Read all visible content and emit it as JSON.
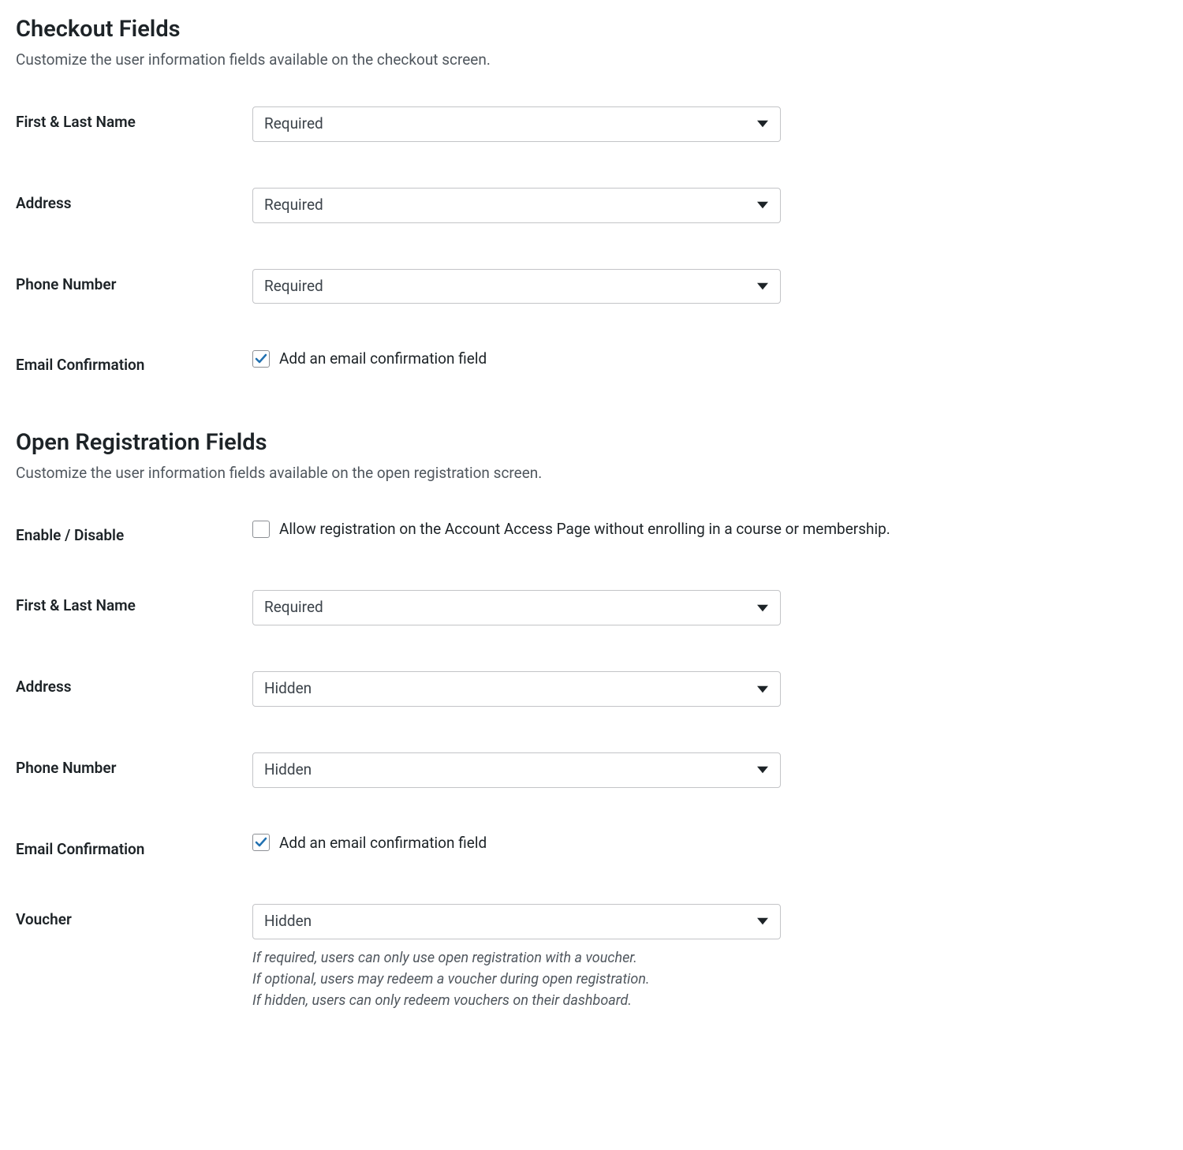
{
  "checkout": {
    "title": "Checkout Fields",
    "description": "Customize the user information fields available on the checkout screen.",
    "fields": {
      "first_last_name": {
        "label": "First & Last Name",
        "value": "Required"
      },
      "address": {
        "label": "Address",
        "value": "Required"
      },
      "phone": {
        "label": "Phone Number",
        "value": "Required"
      },
      "email_confirmation": {
        "label": "Email Confirmation",
        "checkbox_label": "Add an email confirmation field",
        "checked": true
      }
    }
  },
  "open_registration": {
    "title": "Open Registration Fields",
    "description": "Customize the user information fields available on the open registration screen.",
    "fields": {
      "enable_disable": {
        "label": "Enable / Disable",
        "checkbox_label": "Allow registration on the Account Access Page without enrolling in a course or membership.",
        "checked": false
      },
      "first_last_name": {
        "label": "First & Last Name",
        "value": "Required"
      },
      "address": {
        "label": "Address",
        "value": "Hidden"
      },
      "phone": {
        "label": "Phone Number",
        "value": "Hidden"
      },
      "email_confirmation": {
        "label": "Email Confirmation",
        "checkbox_label": "Add an email confirmation field",
        "checked": true
      },
      "voucher": {
        "label": "Voucher",
        "value": "Hidden",
        "help": [
          "If required, users can only use open registration with a voucher.",
          "If optional, users may redeem a voucher during open registration.",
          "If hidden, users can only redeem vouchers on their dashboard."
        ]
      }
    }
  }
}
